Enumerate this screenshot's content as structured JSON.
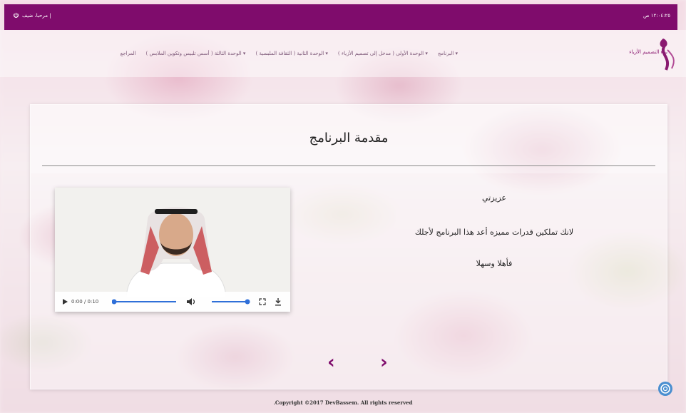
{
  "topbar": {
    "time": "١٢:٠٤:٢٥ ص",
    "welcome": "مرحبا، ضيف |"
  },
  "logo": {
    "text": "بناء التصميم الأزياء"
  },
  "nav": {
    "items": [
      "البرنامج ▾",
      "الوحدة الأولى ( مدخل إلى تصميم الأزياء ) ▾",
      "الوحدة الثانية ( الثقافة الملبسية ) ▾",
      "الوحدة الثالثة ( أسس تلبيس وتكوين الملابس ) ▾",
      "المراجع"
    ]
  },
  "main": {
    "title": "مقدمة البرنامج",
    "greeting": "عزيزتي",
    "message": "لانك تملكين قدرات مميزه أعد هذا البرنامج لأجلك",
    "welcome": "فأهلا وسهلا"
  },
  "video": {
    "time": "0:00 / 0:10",
    "progress": 0.0,
    "volume": 1.0
  },
  "pager": {
    "prev": "‹",
    "next": "›"
  },
  "footer": {
    "copyright": ".Copyright ©2017 DevBassem. All rights reserved"
  },
  "colors": {
    "brand": "#7f0c6c",
    "slider": "#2f6fd8",
    "help": "#4a8fd0"
  }
}
